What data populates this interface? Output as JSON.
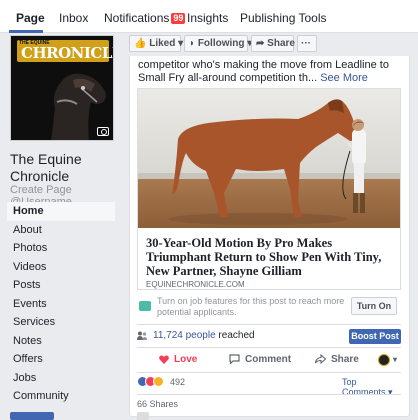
{
  "topnav": {
    "tabs": [
      {
        "label": "Page",
        "active": true
      },
      {
        "label": "Inbox"
      },
      {
        "label": "Notifications",
        "badge": "99"
      },
      {
        "label": "Insights"
      },
      {
        "label": "Publishing Tools"
      }
    ]
  },
  "page": {
    "logo_small": "THE EQUINE",
    "logo_name": "CHRONICLE",
    "name": "The Equine Chronicle",
    "username_prompt": "Create Page @Username"
  },
  "sidebar": {
    "items": [
      "Home",
      "About",
      "Photos",
      "Videos",
      "Posts",
      "Events",
      "Services",
      "Notes",
      "Offers",
      "Jobs",
      "Community"
    ]
  },
  "actionbar": {
    "liked": "Liked",
    "following": "Following",
    "share": "Share",
    "more": "···"
  },
  "post": {
    "text": "competitor who's making the move from Leadline to Small Fry all-around competition th...",
    "see_more": "See More",
    "link_title": "30-Year-Old Motion By Pro Makes Triumphant Return to Show Pen With Tiny, New Partner, Shayne Gilliam",
    "link_domain": "EQUINECHRONICLE.COM",
    "jobs_text": "Turn on job features for this post to reach more potential applicants.",
    "turn_on": "Turn On",
    "reach_count": "11,724 people",
    "reach_suffix": " reached",
    "boost": "Boost Post",
    "love": "Love",
    "comment": "Comment",
    "share": "Share",
    "reaction_count": "492",
    "top_comments": "Top Comments ▾",
    "shares": "66 Shares"
  },
  "colors": {
    "brand_blue": "#4267b2",
    "link_blue": "#385898",
    "love_red": "#f33e58",
    "logo_gold": "#d0a019",
    "badge_red": "#fa3e3e"
  }
}
